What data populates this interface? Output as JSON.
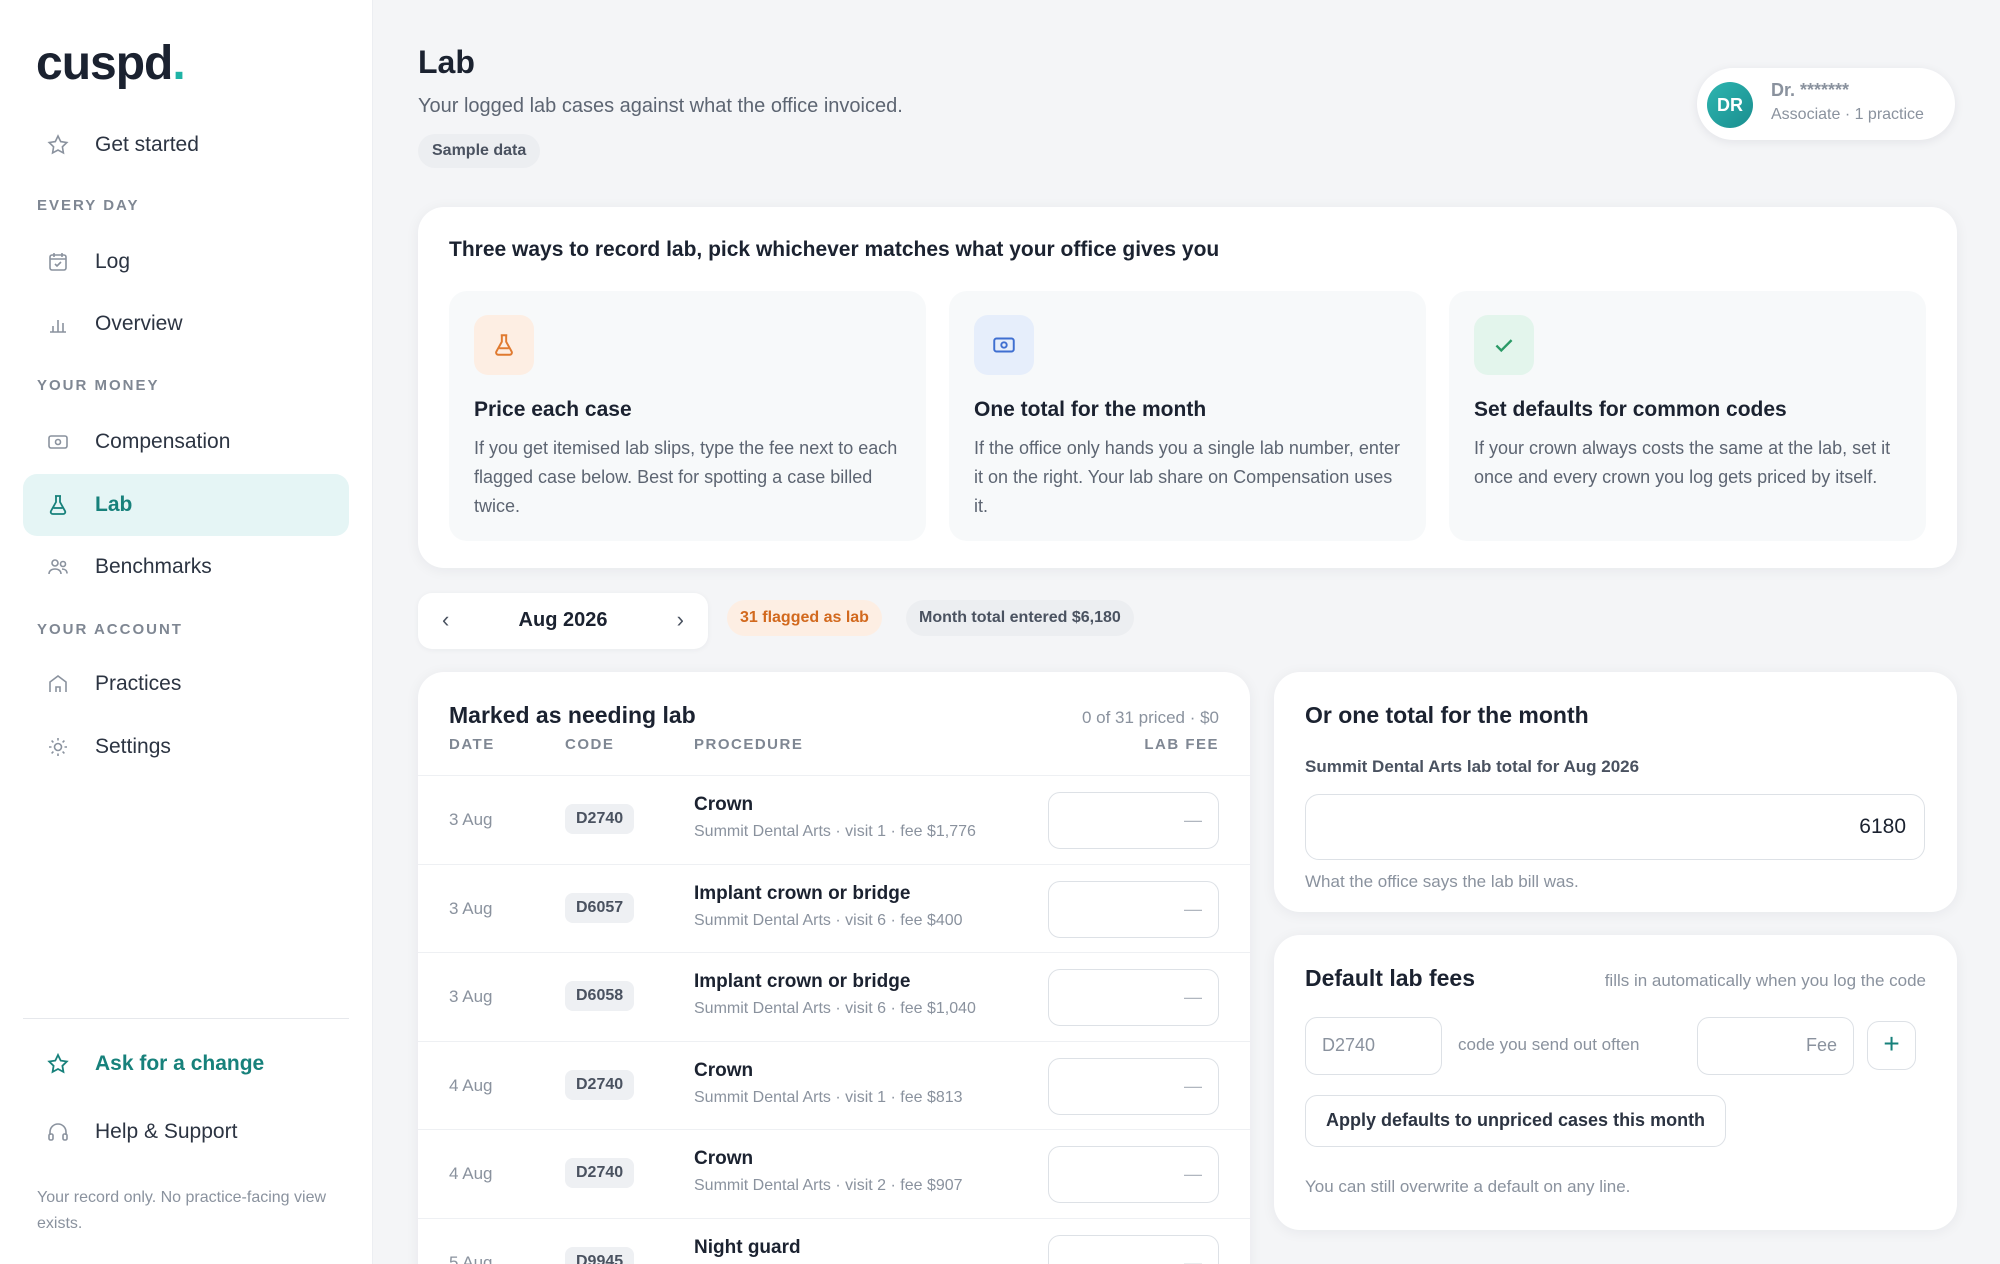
{
  "brand": {
    "logo_text": "cuspd",
    "logo_dot": "."
  },
  "sidebar": {
    "get_started": "Get started",
    "section_everyday": "EVERY DAY",
    "log": "Log",
    "overview": "Overview",
    "section_money": "YOUR MONEY",
    "compensation": "Compensation",
    "lab": "Lab",
    "benchmarks": "Benchmarks",
    "section_account": "YOUR ACCOUNT",
    "practices": "Practices",
    "settings": "Settings",
    "ask_change": "Ask for a change",
    "help": "Help & Support",
    "footer_note": "Your record only. No practice-facing view exists."
  },
  "header": {
    "title": "Lab",
    "subtitle": "Your logged lab cases against what the office invoiced.",
    "sample_chip": "Sample data"
  },
  "user": {
    "initials": "DR",
    "name": "Dr. *******",
    "role": "Associate · 1 practice"
  },
  "ways": {
    "title": "Three ways to record lab, pick whichever matches what your office gives you",
    "items": [
      {
        "title": "Price each case",
        "text": "If you get itemised lab slips, type the fee next to each flagged case below. Best for spotting a case billed twice.",
        "icon": "flask-icon"
      },
      {
        "title": "One total for the month",
        "text": "If the office only hands you a single lab number, enter it on the right. Your lab share on Compensation uses it.",
        "icon": "banknote-icon"
      },
      {
        "title": "Set defaults for common codes",
        "text": "If your crown always costs the same at the lab, set it once and every crown you log gets priced by itself.",
        "icon": "check-icon"
      }
    ]
  },
  "month_nav": {
    "prev": "‹",
    "label": "Aug 2026",
    "next": "›"
  },
  "chips": {
    "flagged": "31 flagged as lab",
    "month_total": "Month total entered $6,180"
  },
  "table": {
    "title": "Marked as needing lab",
    "count": "0 of 31 priced · $0",
    "headers": {
      "date": "DATE",
      "code": "CODE",
      "procedure": "PROCEDURE",
      "fee": "LAB FEE"
    },
    "fee_placeholder": "—",
    "rows": [
      {
        "date": "3 Aug",
        "code": "D2740",
        "procedure": "Crown",
        "meta": "Summit Dental Arts · visit 1 · fee $1,776"
      },
      {
        "date": "3 Aug",
        "code": "D6057",
        "procedure": "Implant crown or bridge",
        "meta": "Summit Dental Arts · visit 6 · fee $400"
      },
      {
        "date": "3 Aug",
        "code": "D6058",
        "procedure": "Implant crown or bridge",
        "meta": "Summit Dental Arts · visit 6 · fee $1,040"
      },
      {
        "date": "4 Aug",
        "code": "D2740",
        "procedure": "Crown",
        "meta": "Summit Dental Arts · visit 1 · fee $813"
      },
      {
        "date": "4 Aug",
        "code": "D2740",
        "procedure": "Crown",
        "meta": "Summit Dental Arts · visit 2 · fee $907"
      },
      {
        "date": "5 Aug",
        "code": "D9945",
        "procedure": "Night guard",
        "meta": ""
      }
    ]
  },
  "month_total": {
    "title": "Or one total for the month",
    "label": "Summit Dental Arts lab total for Aug 2026",
    "value": "6180",
    "help": "What the office says the lab bill was."
  },
  "defaults": {
    "title": "Default lab fees",
    "hint": "fills in automatically when you log the code",
    "code_placeholder": "D2740",
    "code_note": "code you send out often",
    "fee_placeholder": "Fee",
    "add_label": "+",
    "apply_label": "Apply defaults to unpriced cases this month",
    "note": "You can still overwrite a default on any line."
  },
  "colors": {
    "accent": "#17817b",
    "flag": "#d2691e",
    "active_bg": "#e5f5f5"
  }
}
